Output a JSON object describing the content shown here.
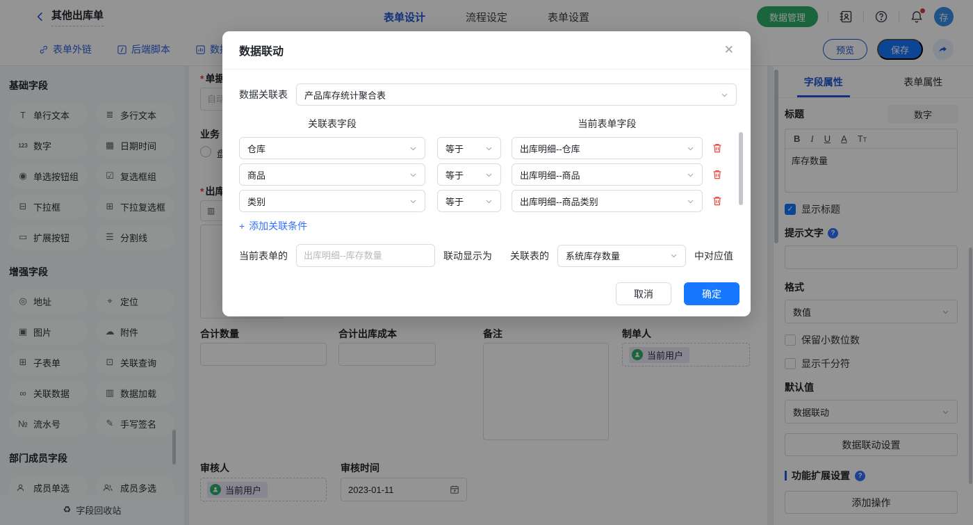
{
  "topbar": {
    "title": "其他出库单",
    "tabs": [
      {
        "label": "表单设计"
      },
      {
        "label": "流程设定"
      },
      {
        "label": "表单设置"
      }
    ],
    "data_manage": "数据管理",
    "avatar": "存"
  },
  "toolbar": {
    "form_link": "表单外链",
    "backend_script": "后端脚本",
    "data_permission": "数据权限",
    "preview": "预览",
    "save": "保存"
  },
  "sidebar": {
    "sections": [
      {
        "title": "基础字段",
        "items": [
          "单行文本",
          "多行文本",
          "数字",
          "日期时间",
          "单选按钮组",
          "复选框组",
          "下拉框",
          "下拉复选框",
          "扩展按钮",
          "分割线"
        ]
      },
      {
        "title": "增强字段",
        "items": [
          "地址",
          "定位",
          "图片",
          "附件",
          "子表单",
          "关联查询",
          "关联数据",
          "数据加载",
          "流水号",
          "手写签名"
        ]
      },
      {
        "title": "部门成员字段",
        "items": [
          "成员单选",
          "成员多选"
        ]
      }
    ],
    "recycle": "字段回收站"
  },
  "canvas": {
    "partial": {
      "doc_no_label": "单据",
      "doc_no_placeholder": "自动",
      "biz_label": "业务",
      "radio_label": "盘",
      "outbound_label": "出库"
    },
    "total_qty_label": "合计数量",
    "total_cost_label": "合计出库成本",
    "remark_label": "备注",
    "creator_label": "制单人",
    "creator_value": "当前用户",
    "reviewer_label": "审核人",
    "reviewer_value": "当前用户",
    "review_time_label": "审核时间",
    "review_time_value": "2023-01-11"
  },
  "modal": {
    "title": "数据联动",
    "relation_table_label": "数据关联表",
    "relation_table_value": "产品库存统计聚合表",
    "col_left_header": "关联表字段",
    "col_right_header": "当前表单字段",
    "conditions": [
      {
        "left": "仓库",
        "op": "等于",
        "right": "出库明细--仓库"
      },
      {
        "left": "商品",
        "op": "等于",
        "right": "出库明细--商品"
      },
      {
        "left": "类别",
        "op": "等于",
        "right": "出库明细--商品类别"
      }
    ],
    "add_plus": "+",
    "add_label": "添加关联条件",
    "mapping": {
      "prefix": "当前表单的",
      "target_placeholder": "出库明细--库存数量",
      "middle": "联动显示为",
      "table_label": "关联表的",
      "source_value": "系统库存数量",
      "suffix": "中对应值"
    },
    "cancel": "取消",
    "confirm": "确定"
  },
  "panel": {
    "tabs": [
      {
        "label": "字段属性"
      },
      {
        "label": "表单属性"
      }
    ],
    "title_label": "标题",
    "field_type": "数字",
    "format_buttons": {
      "bold": "B",
      "italic": "I",
      "underline": "U",
      "color": "A",
      "size": "T"
    },
    "title_value": "库存数量",
    "show_title": "显示标题",
    "hint_label": "提示文字",
    "format_label": "格式",
    "format_value": "数值",
    "decimal_label": "保留小数位数",
    "thousand_label": "显示千分符",
    "default_label": "默认值",
    "default_value": "数据联动",
    "linkage_setting": "数据联动设置",
    "extension_label": "功能扩展设置",
    "add_action": "添加操作",
    "check_glyph": "✓"
  }
}
